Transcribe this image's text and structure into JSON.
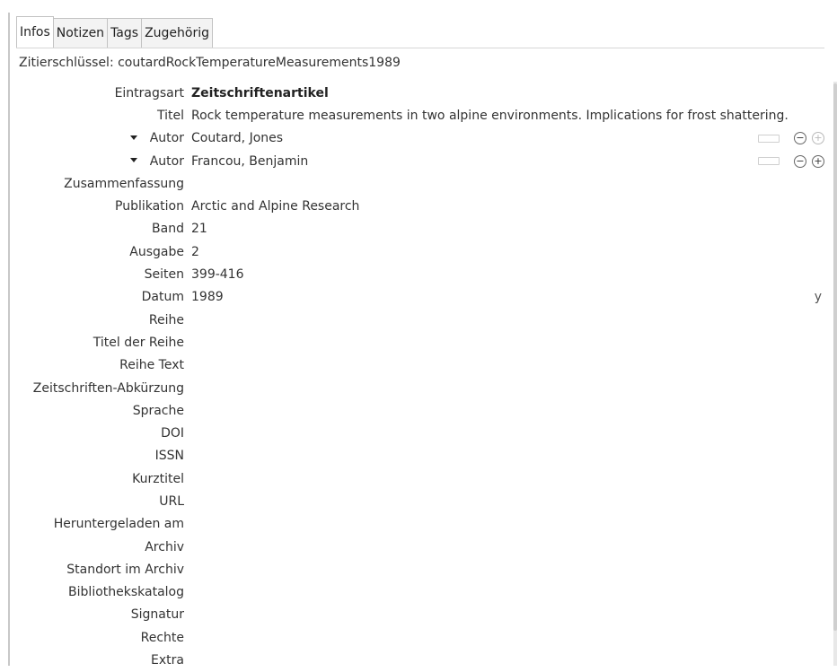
{
  "tabs": [
    {
      "label": "Infos",
      "active": true
    },
    {
      "label": "Notizen",
      "active": false
    },
    {
      "label": "Tags",
      "active": false
    },
    {
      "label": "Zugehörig",
      "active": false
    }
  ],
  "citation_key": "Zitierschlüssel: coutardRockTemperatureMeasurements1989",
  "fields": {
    "item_type": {
      "label": "Eintragsart",
      "value": "Zeitschriftenartikel"
    },
    "title": {
      "label": "Titel",
      "value": "Rock temperature measurements in two alpine environments. Implications for frost shattering."
    },
    "creators": [
      {
        "label": "Autor",
        "value": "Coutard, Jones",
        "minus_icon": "minus-circle-icon",
        "plus_icon": "plus-circle-icon"
      },
      {
        "label": "Autor",
        "value": "Francou, Benjamin",
        "minus_icon": "minus-circle-icon",
        "plus_icon": "plus-circle-icon"
      }
    ],
    "abstract": {
      "label": "Zusammenfassung",
      "value": ""
    },
    "publication": {
      "label": "Publikation",
      "value": "Arctic and Alpine Research"
    },
    "volume": {
      "label": "Band",
      "value": "21"
    },
    "issue": {
      "label": "Ausgabe",
      "value": "2"
    },
    "pages": {
      "label": "Seiten",
      "value": "399-416"
    },
    "date": {
      "label": "Datum",
      "value": "1989",
      "flag": "y"
    },
    "series": {
      "label": "Reihe",
      "value": ""
    },
    "series_title": {
      "label": "Titel der Reihe",
      "value": ""
    },
    "series_text": {
      "label": "Reihe Text",
      "value": ""
    },
    "journal_abbr": {
      "label": "Zeitschriften-Abkürzung",
      "value": ""
    },
    "language": {
      "label": "Sprache",
      "value": ""
    },
    "doi": {
      "label": "DOI",
      "value": ""
    },
    "issn": {
      "label": "ISSN",
      "value": ""
    },
    "short_title": {
      "label": "Kurztitel",
      "value": ""
    },
    "url": {
      "label": "URL",
      "value": ""
    },
    "accessed": {
      "label": "Heruntergeladen am",
      "value": ""
    },
    "archive": {
      "label": "Archiv",
      "value": ""
    },
    "archive_location": {
      "label": "Standort im Archiv",
      "value": ""
    },
    "library_catalog": {
      "label": "Bibliothekskatalog",
      "value": ""
    },
    "call_number": {
      "label": "Signatur",
      "value": ""
    },
    "rights": {
      "label": "Rechte",
      "value": ""
    },
    "extra": {
      "label": "Extra",
      "value": ""
    }
  },
  "icons": {
    "twisty": "chevron-down-icon",
    "swap": "swap-name-toggle-icon",
    "minus": "minus-circle-icon",
    "plus": "plus-circle-icon"
  },
  "colors": {
    "tab_border": "#c2c2c2",
    "tab_bg": "#f3f3f3",
    "text": "#333333"
  }
}
